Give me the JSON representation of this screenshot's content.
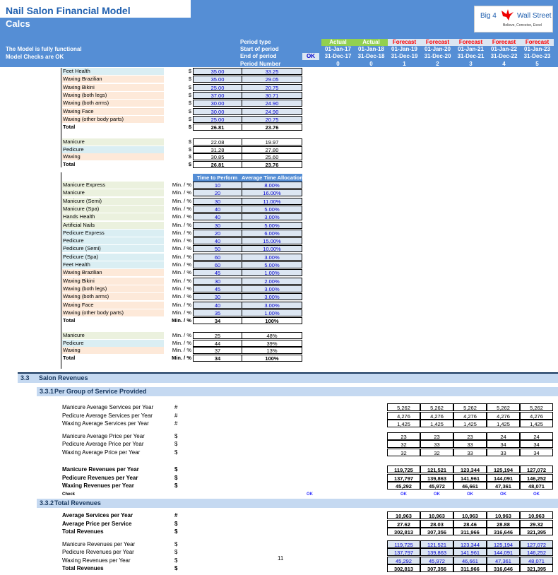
{
  "header": {
    "title": "Nail Salon Financial Model",
    "sheet": "Calcs",
    "status_lines": [
      "The Model is fully functional",
      "Model Checks are OK"
    ],
    "period_labels": [
      "Period type",
      "Start of period",
      "End of period",
      "Period Number"
    ],
    "ok_badge": "OK",
    "logo": {
      "left": "Big 4",
      "right": "Wall Street",
      "tagline": "Believe, Conceive, Excel"
    },
    "periods": [
      {
        "type": "Actual",
        "start": "01-Jan-17",
        "end": "31-Dec-17",
        "number": "0"
      },
      {
        "type": "Actual",
        "start": "01-Jan-18",
        "end": "31-Dec-18",
        "number": "0"
      },
      {
        "type": "Forecast",
        "start": "01-Jan-19",
        "end": "31-Dec-19",
        "number": "1"
      },
      {
        "type": "Forecast",
        "start": "01-Jan-20",
        "end": "31-Dec-20",
        "number": "2"
      },
      {
        "type": "Forecast",
        "start": "01-Jan-21",
        "end": "31-Dec-21",
        "number": "3"
      },
      {
        "type": "Forecast",
        "start": "01-Jan-22",
        "end": "31-Dec-22",
        "number": "4"
      },
      {
        "type": "Forecast",
        "start": "01-Jan-23",
        "end": "31-Dec-23",
        "number": "5"
      }
    ],
    "colors": {
      "header_blue": "#558ED5",
      "actual_green": "#92D050",
      "forecast_red": "#FF0000",
      "input_blue": "#0000CC"
    }
  },
  "price_table": {
    "rows": [
      {
        "label": "Feet Health",
        "group": "p",
        "unit": "$",
        "v1": "35.00",
        "v2": "33.25"
      },
      {
        "label": "Waxing Brazilian",
        "group": "w",
        "unit": "$",
        "v1": "35.00",
        "v2": "29.05"
      },
      {
        "label": "Waxing Bikini",
        "group": "w",
        "unit": "$",
        "v1": "25.00",
        "v2": "20.75"
      },
      {
        "label": "Waxing (both legs)",
        "group": "w",
        "unit": "$",
        "v1": "37.00",
        "v2": "30.71"
      },
      {
        "label": "Waxing (both arms)",
        "group": "w",
        "unit": "$",
        "v1": "30.00",
        "v2": "24.90"
      },
      {
        "label": "Waxing Face",
        "group": "w",
        "unit": "$",
        "v1": "30.00",
        "v2": "24.90"
      },
      {
        "label": "Waxing (other body parts)",
        "group": "w",
        "unit": "$",
        "v1": "25.00",
        "v2": "20.75"
      }
    ],
    "total": {
      "label": "Total",
      "unit": "$",
      "v1": "26.81",
      "v2": "23.76"
    },
    "groups": [
      {
        "label": "Manicure",
        "group": "m",
        "unit": "$",
        "v1": "22.08",
        "v2": "19.97"
      },
      {
        "label": "Pedicure",
        "group": "p",
        "unit": "$",
        "v1": "31.28",
        "v2": "27.80"
      },
      {
        "label": "Waxing",
        "group": "w",
        "unit": "$",
        "v1": "30.85",
        "v2": "25.60"
      }
    ],
    "group_total": {
      "label": "Total",
      "unit": "$",
      "v1": "26.81",
      "v2": "23.76"
    }
  },
  "time_table": {
    "headers": [
      "Time to Perform",
      "Average Time Allocation"
    ],
    "rows": [
      {
        "label": "Manicure Express",
        "group": "m",
        "unit": "Min. / %",
        "v1": "10",
        "v2": "8.00%"
      },
      {
        "label": "Manicure",
        "group": "m",
        "unit": "Min. / %",
        "v1": "20",
        "v2": "16.00%"
      },
      {
        "label": "Manicure (Semi)",
        "group": "m",
        "unit": "Min. / %",
        "v1": "30",
        "v2": "11.00%"
      },
      {
        "label": "Manicure (Spa)",
        "group": "m",
        "unit": "Min. / %",
        "v1": "40",
        "v2": "5.00%"
      },
      {
        "label": "Hands Health",
        "group": "m",
        "unit": "Min. / %",
        "v1": "40",
        "v2": "3.00%"
      },
      {
        "label": "Artificial Nails",
        "group": "m",
        "unit": "Min. / %",
        "v1": "30",
        "v2": "5.00%"
      },
      {
        "label": "Pedicure Express",
        "group": "p",
        "unit": "Min. / %",
        "v1": "20",
        "v2": "6.00%"
      },
      {
        "label": "Pedicure",
        "group": "p",
        "unit": "Min. / %",
        "v1": "40",
        "v2": "15.00%"
      },
      {
        "label": "Pedicure (Semi)",
        "group": "p",
        "unit": "Min. / %",
        "v1": "50",
        "v2": "10.00%"
      },
      {
        "label": "Pedicure (Spa)",
        "group": "p",
        "unit": "Min. / %",
        "v1": "60",
        "v2": "3.00%"
      },
      {
        "label": "Feet Health",
        "group": "p",
        "unit": "Min. / %",
        "v1": "60",
        "v2": "5.00%"
      },
      {
        "label": "Waxing Brazilian",
        "group": "w",
        "unit": "Min. / %",
        "v1": "45",
        "v2": "1.00%"
      },
      {
        "label": "Waxing Bikini",
        "group": "w",
        "unit": "Min. / %",
        "v1": "30",
        "v2": "2.00%"
      },
      {
        "label": "Waxing (both legs)",
        "group": "w",
        "unit": "Min. / %",
        "v1": "45",
        "v2": "3.00%"
      },
      {
        "label": "Waxing (both arms)",
        "group": "w",
        "unit": "Min. / %",
        "v1": "30",
        "v2": "3.00%"
      },
      {
        "label": "Waxing Face",
        "group": "w",
        "unit": "Min. / %",
        "v1": "40",
        "v2": "3.00%"
      },
      {
        "label": "Waxing (other body parts)",
        "group": "w",
        "unit": "Min. / %",
        "v1": "35",
        "v2": "1.00%"
      }
    ],
    "total": {
      "label": "Total",
      "unit": "Min. / %",
      "v1": "34",
      "v2": "100%"
    },
    "groups": [
      {
        "label": "Manicure",
        "group": "m",
        "unit": "Min. / %",
        "v1": "25",
        "v2": "48%"
      },
      {
        "label": "Pedicure",
        "group": "p",
        "unit": "Min. / %",
        "v1": "44",
        "v2": "39%"
      },
      {
        "label": "Waxing",
        "group": "w",
        "unit": "Min. / %",
        "v1": "37",
        "v2": "13%"
      }
    ],
    "group_total": {
      "label": "Total",
      "unit": "Min. / %",
      "v1": "34",
      "v2": "100%"
    }
  },
  "section_3_3": {
    "num": "3.3",
    "title": "Salon Revenues"
  },
  "section_3_3_1": {
    "num": "3.3.1",
    "title": "Per Group of Service Provided",
    "blocks": [
      [
        {
          "label": "Manicure Average Services per Year",
          "unit": "#",
          "values": [
            "5,262",
            "5,262",
            "5,262",
            "5,262",
            "5,262"
          ]
        },
        {
          "label": "Pedicure Average Services per Year",
          "unit": "#",
          "values": [
            "4,276",
            "4,276",
            "4,276",
            "4,276",
            "4,276"
          ]
        },
        {
          "label": "Waxing Average Services per Year",
          "unit": "#",
          "values": [
            "1,425",
            "1,425",
            "1,425",
            "1,425",
            "1,425"
          ]
        }
      ],
      [
        {
          "label": "Manicure Average Price per Year",
          "unit": "$",
          "values": [
            "23",
            "23",
            "23",
            "24",
            "24"
          ]
        },
        {
          "label": "Pedicure Average Price per Year",
          "unit": "$",
          "values": [
            "32",
            "33",
            "33",
            "34",
            "34"
          ]
        },
        {
          "label": "Waxing Average Price per Year",
          "unit": "$",
          "values": [
            "32",
            "32",
            "33",
            "33",
            "34"
          ]
        }
      ],
      [
        {
          "label": "Manicure Revenues per Year",
          "unit": "$",
          "bold": true,
          "values": [
            "119,725",
            "121,521",
            "123,344",
            "125,194",
            "127,072"
          ]
        },
        {
          "label": "Pedicure Revenues per Year",
          "unit": "$",
          "bold": true,
          "values": [
            "137,797",
            "139,863",
            "141,961",
            "144,091",
            "146,252"
          ]
        },
        {
          "label": "Waxing Revenues per Year",
          "unit": "$",
          "bold": true,
          "values": [
            "45,292",
            "45,972",
            "46,661",
            "47,361",
            "48,071"
          ]
        }
      ]
    ],
    "check": {
      "label": "Check",
      "summary": "OK",
      "values": [
        "OK",
        "OK",
        "OK",
        "OK",
        "OK"
      ]
    }
  },
  "section_3_3_2": {
    "num": "3.3.2",
    "title": "Total Revenues",
    "blocks": [
      [
        {
          "label": "Average Services per Year",
          "unit": "#",
          "bold": true,
          "values": [
            "10,963",
            "10,963",
            "10,963",
            "10,963",
            "10,963"
          ]
        },
        {
          "label": "Average Price per Service",
          "unit": "$",
          "bold": true,
          "values": [
            "27.62",
            "28.03",
            "28.46",
            "28.88",
            "29.32"
          ]
        },
        {
          "label": "Total Revenues",
          "unit": "$",
          "bold": true,
          "values": [
            "302,813",
            "307,356",
            "311,966",
            "316,646",
            "321,395"
          ]
        }
      ],
      [
        {
          "label": "Manicure Revenues per Year",
          "unit": "$",
          "input": true,
          "values": [
            "119,725",
            "121,521",
            "123,344",
            "125,194",
            "127,072"
          ]
        },
        {
          "label": "Pedicure Revenues per Year",
          "unit": "$",
          "input": true,
          "values": [
            "137,797",
            "139,863",
            "141,961",
            "144,091",
            "146,252"
          ]
        },
        {
          "label": "Waxing Revenues per Year",
          "unit": "$",
          "input": true,
          "values": [
            "45,292",
            "45,972",
            "46,661",
            "47,361",
            "48,071"
          ]
        },
        {
          "label": "Total Revenues",
          "unit": "$",
          "bold": true,
          "values": [
            "302,813",
            "307,356",
            "311,966",
            "316,646",
            "321,395"
          ]
        }
      ]
    ]
  },
  "footer": {
    "page_number": "11",
    "overlap_text": "Nail Sa"
  }
}
